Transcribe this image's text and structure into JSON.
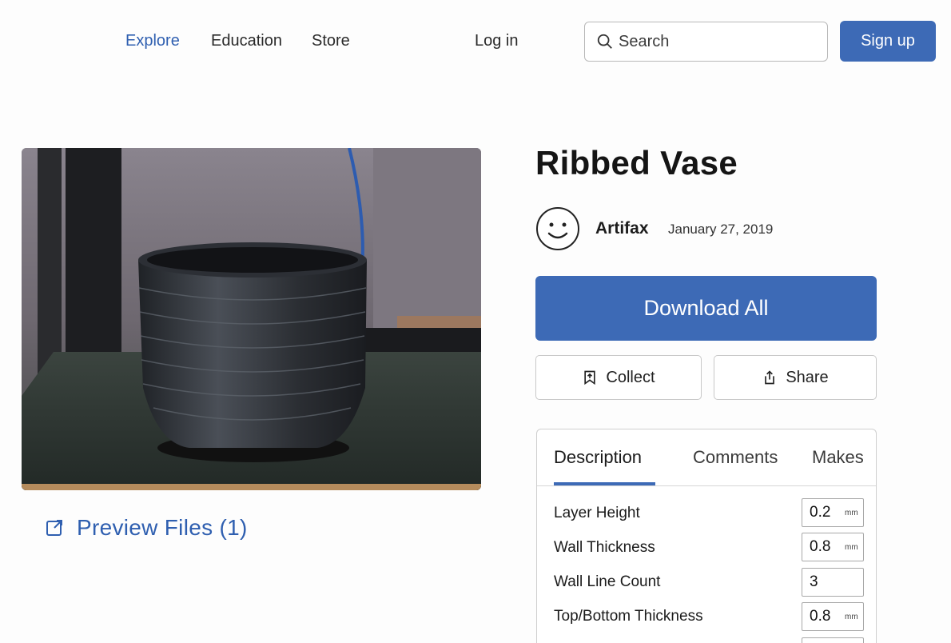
{
  "nav": {
    "links": [
      "Explore",
      "Education",
      "Store"
    ],
    "login": "Log in",
    "search_placeholder": "Search",
    "signup": "Sign up",
    "accent_color": "#3d6ab6"
  },
  "model": {
    "title": "Ribbed Vase",
    "author": "Artifax",
    "date": "January 27, 2019",
    "preview_files": "Preview Files (1)"
  },
  "actions": {
    "download": "Download All",
    "collect": "Collect",
    "share": "Share"
  },
  "tabs": [
    "Description",
    "Comments",
    "Makes"
  ],
  "settings": [
    {
      "label": "Layer Height",
      "value": "0.2",
      "unit": "mm"
    },
    {
      "label": "Wall Thickness",
      "value": "0.8",
      "unit": "mm"
    },
    {
      "label": "Wall Line Count",
      "value": "3",
      "unit": ""
    },
    {
      "label": "Top/Bottom Thickness",
      "value": "0.8",
      "unit": "mm"
    }
  ],
  "icons": {
    "search": "search-icon",
    "avatar": "smiley-avatar-icon",
    "preview": "external-link-icon",
    "collect": "bookmark-icon",
    "share": "share-icon"
  }
}
